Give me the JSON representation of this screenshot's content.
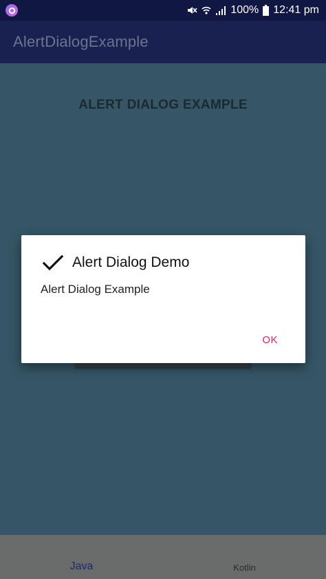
{
  "status_bar": {
    "battery": "100%",
    "time": "12:41 pm",
    "icons": [
      "app-badge-icon",
      "mute-icon",
      "wifi-icon",
      "signal-icon",
      "battery-icon"
    ]
  },
  "app_bar": {
    "title": "AlertDialogExample"
  },
  "content": {
    "heading": "ALERT DIALOG EXAMPLE"
  },
  "dialog": {
    "icon": "check-icon",
    "title": "Alert Dialog Demo",
    "message": "Alert Dialog Example",
    "ok_label": "OK"
  },
  "bottom_nav": {
    "items": [
      {
        "label": "Java",
        "selected": true
      },
      {
        "label": "Kotlin",
        "selected": false
      }
    ]
  },
  "colors": {
    "status_bar": "#101743",
    "app_bar": "#18214f",
    "background": "#365666",
    "accent": "#e91e63"
  }
}
